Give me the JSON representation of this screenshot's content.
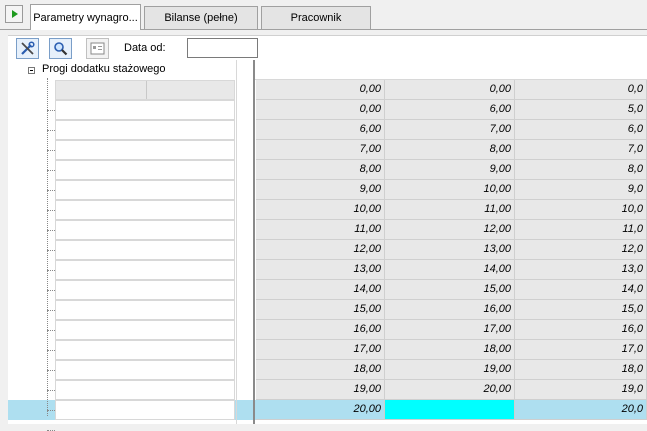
{
  "tabs": [
    {
      "label": "Parametry wynagro...",
      "active": true
    },
    {
      "label": "Bilanse (pełne)",
      "active": false
    },
    {
      "label": "Pracownik",
      "active": false
    }
  ],
  "toolbar": {
    "tools_icon": "tools-icon",
    "search_icon": "magnifier-icon",
    "calendar_icon": "calendar-icon",
    "date_label": "Data od:",
    "date_value": ""
  },
  "tree": {
    "node_label": "Progi dodatku stażowego"
  },
  "table": {
    "rows": [
      [
        "0,00",
        "0,00",
        "0,0"
      ],
      [
        "0,00",
        "6,00",
        "5,0"
      ],
      [
        "6,00",
        "7,00",
        "6,0"
      ],
      [
        "7,00",
        "8,00",
        "7,0"
      ],
      [
        "8,00",
        "9,00",
        "8,0"
      ],
      [
        "9,00",
        "10,00",
        "9,0"
      ],
      [
        "10,00",
        "11,00",
        "10,0"
      ],
      [
        "11,00",
        "12,00",
        "11,0"
      ],
      [
        "12,00",
        "13,00",
        "12,0"
      ],
      [
        "13,00",
        "14,00",
        "13,0"
      ],
      [
        "14,00",
        "15,00",
        "14,0"
      ],
      [
        "15,00",
        "16,00",
        "15,0"
      ],
      [
        "16,00",
        "17,00",
        "16,0"
      ],
      [
        "17,00",
        "18,00",
        "17,0"
      ],
      [
        "18,00",
        "19,00",
        "18,0"
      ],
      [
        "19,00",
        "20,00",
        "19,0"
      ],
      [
        "20,00",
        "",
        "20,0"
      ]
    ],
    "selected_row": 16
  },
  "colors": {
    "selection": "#aedff0",
    "active_cell": "#00ffff",
    "cell_bg": "#e8e8e8"
  }
}
